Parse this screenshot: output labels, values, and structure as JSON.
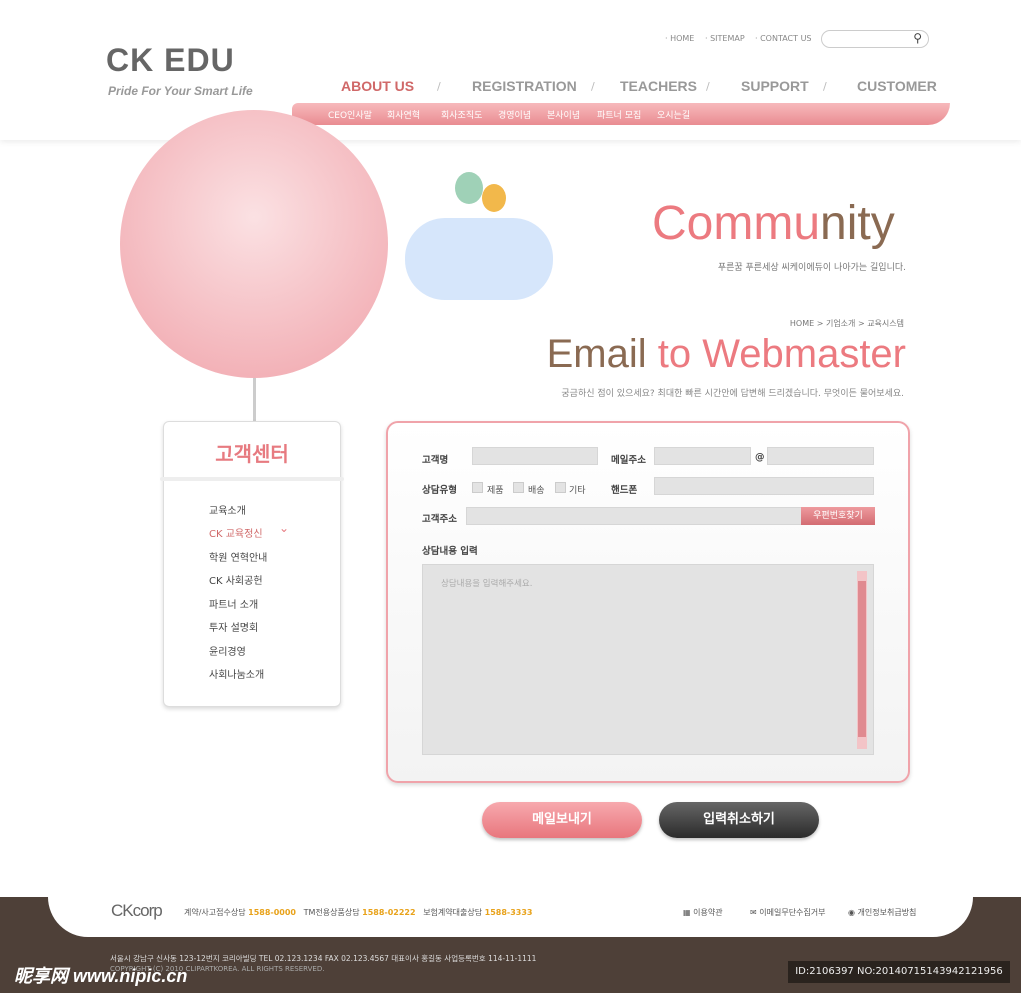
{
  "logo": {
    "name": "CK EDU",
    "slogan": "Pride For Your Smart Life"
  },
  "util": [
    "· HOME",
    "· SITEMAP",
    "· CONTACT US"
  ],
  "search": {
    "icon": "search-icon",
    "placeholder": ""
  },
  "gnav": [
    "ABOUT US",
    "REGISTRATION",
    "TEACHERS",
    "SUPPORT",
    "CUSTOMER"
  ],
  "subnav": [
    "CEO인사말",
    "회사연혁",
    "회사조직도",
    "경영이념",
    "본사이념",
    "파트너 모집",
    "오시는길"
  ],
  "hero": {
    "title_a": "Commu",
    "title_b": "nity",
    "subtitle": "푸른꿈 푸른세상 씨케이에듀이 나아가는 길입니다."
  },
  "breadcrumb": "HOME > 기업소개 > 교육시스템",
  "page": {
    "title_a": "Email ",
    "title_b": "to Webmaster",
    "desc": "궁금하신 점이 있으세요? 최대한 빠른 시간안에 답변해 드리겠습니다. 무엇이든 물어보세요."
  },
  "sidebar": {
    "title": "고객센터",
    "items": [
      "교육소개",
      "CK 교육정신",
      "학원 연혁안내",
      "CK 사회공헌",
      "파트너 소개",
      "투자 설명회",
      "윤리경영",
      "사회나눔소개"
    ],
    "active": 1
  },
  "form": {
    "name": "고객명",
    "email": "메일주소",
    "at": "@",
    "type": "상담유형",
    "types": [
      "제품",
      "배송",
      "기타"
    ],
    "phone": "핸드폰",
    "address": "고객주소",
    "zip_button": "우편번호찾기",
    "content": "상담내용 입력",
    "content_placeholder": "상담내용을 입력해주세요."
  },
  "buttons": {
    "send": "메일보내기",
    "cancel": "입력취소하기"
  },
  "footer": {
    "logo": "CKcorp",
    "c1": "계약/사고접수상담",
    "n1": "1588-0000",
    "c2": "TM전용상품상담",
    "n2": "1588-02222",
    "c3": "보험계약대출상담",
    "n3": "1588-3333",
    "links": [
      "이용약관",
      "이메일무단수집거부",
      "개인정보취급방침"
    ],
    "address": "서울시 강남구 신사동 123-12번지 코리아빌딩   TEL 02.123.1234   FAX 02.123.4567   대표이사 홍길동 사업등록번호 114-11-1111",
    "copyright": "COPYRIGHT (C) 2010 CLIPARTKOREA. ALL RIGHTS RESERVED."
  },
  "watermark": {
    "site": "昵享网 www.nipic.cn",
    "id": "ID:2106397 NO:20140715143942121956"
  },
  "colors": {
    "accent": "#ec7a80",
    "brown": "#8a6a52",
    "footer": "#4e4038"
  }
}
